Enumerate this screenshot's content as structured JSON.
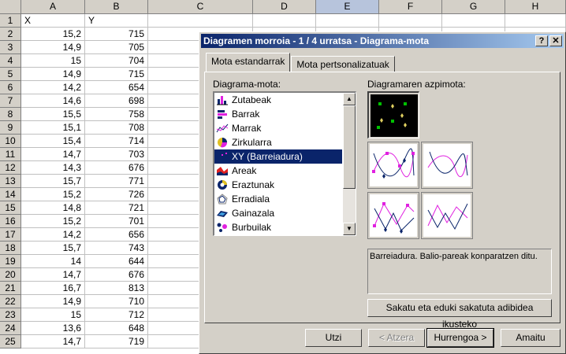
{
  "columns": [
    "A",
    "B",
    "C",
    "D",
    "E",
    "F",
    "G",
    "H"
  ],
  "selected_column": "E",
  "rows": [
    {
      "n": "1",
      "a": "X",
      "b": "Y"
    },
    {
      "n": "2",
      "a": "15,2",
      "b": "715"
    },
    {
      "n": "3",
      "a": "14,9",
      "b": "705"
    },
    {
      "n": "4",
      "a": "15",
      "b": "704"
    },
    {
      "n": "5",
      "a": "14,9",
      "b": "715"
    },
    {
      "n": "6",
      "a": "14,2",
      "b": "654"
    },
    {
      "n": "7",
      "a": "14,6",
      "b": "698"
    },
    {
      "n": "8",
      "a": "15,5",
      "b": "758"
    },
    {
      "n": "9",
      "a": "15,1",
      "b": "708"
    },
    {
      "n": "10",
      "a": "15,4",
      "b": "714"
    },
    {
      "n": "11",
      "a": "14,7",
      "b": "703"
    },
    {
      "n": "12",
      "a": "14,3",
      "b": "676"
    },
    {
      "n": "13",
      "a": "15,7",
      "b": "771"
    },
    {
      "n": "14",
      "a": "15,2",
      "b": "726"
    },
    {
      "n": "15",
      "a": "14,8",
      "b": "721"
    },
    {
      "n": "16",
      "a": "15,2",
      "b": "701"
    },
    {
      "n": "17",
      "a": "14,2",
      "b": "656"
    },
    {
      "n": "18",
      "a": "15,7",
      "b": "743"
    },
    {
      "n": "19",
      "a": "14",
      "b": "644"
    },
    {
      "n": "20",
      "a": "14,7",
      "b": "676"
    },
    {
      "n": "21",
      "a": "16,7",
      "b": "813"
    },
    {
      "n": "22",
      "a": "14,9",
      "b": "710"
    },
    {
      "n": "23",
      "a": "15",
      "b": "712"
    },
    {
      "n": "24",
      "a": "13,6",
      "b": "648"
    },
    {
      "n": "25",
      "a": "14,7",
      "b": "719"
    }
  ],
  "dialog": {
    "title": "Diagramen morroia - 1 / 4 urratsa - Diagrama-mota",
    "help_label": "?",
    "close_label": "✕",
    "tabs": [
      "Mota estandarrak",
      "Mota pertsonalizatuak"
    ],
    "chart_type_label": "Diagrama-mota:",
    "subtype_label": "Diagramaren azpimota:",
    "chart_types": [
      {
        "label": "Zutabeak",
        "icon": "column-chart-icon"
      },
      {
        "label": "Barrak",
        "icon": "bar-chart-icon"
      },
      {
        "label": "Marrak",
        "icon": "line-chart-icon"
      },
      {
        "label": "Zirkularra",
        "icon": "pie-chart-icon"
      },
      {
        "label": "XY (Barreiadura)",
        "icon": "scatter-chart-icon"
      },
      {
        "label": "Areak",
        "icon": "area-chart-icon"
      },
      {
        "label": "Eraztunak",
        "icon": "doughnut-chart-icon"
      },
      {
        "label": "Erradiala",
        "icon": "radar-chart-icon"
      },
      {
        "label": "Gainazala",
        "icon": "surface-chart-icon"
      },
      {
        "label": "Burbuilak",
        "icon": "bubble-chart-icon"
      }
    ],
    "selected_chart_type": "XY (Barreiadura)",
    "description": "Barreiadura. Balio-pareak konparatzen ditu.",
    "preview_button": "Sakatu eta eduki sakatuta adibidea ikusteko",
    "buttons": {
      "cancel": "Utzi",
      "back": "< Atzera",
      "next": "Hurrengoa >",
      "finish": "Amaitu"
    }
  }
}
